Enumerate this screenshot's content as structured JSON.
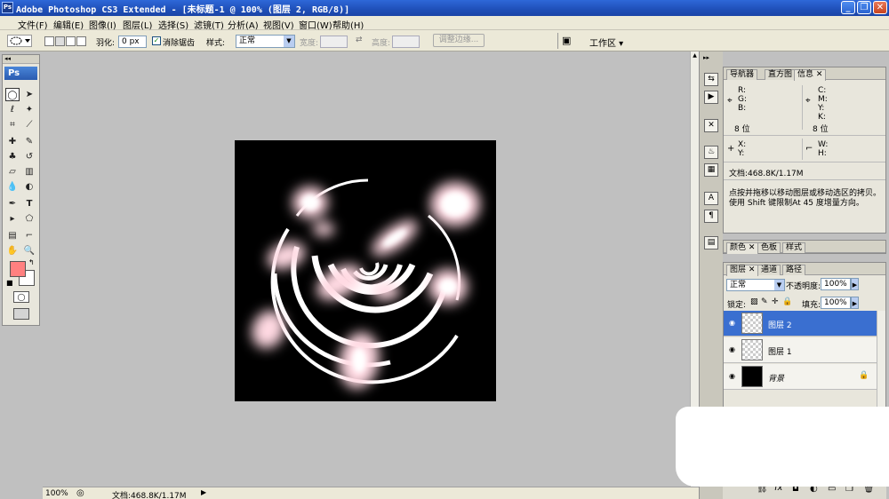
{
  "window": {
    "app_icon": "Ps",
    "title": "Adobe Photoshop CS3 Extended - [未标题-1 @ 100% (图层 2, RGB/8)]",
    "controls": [
      "_",
      "❐",
      "✕"
    ]
  },
  "menu": [
    "文件(F)",
    "编辑(E)",
    "图像(I)",
    "图层(L)",
    "选择(S)",
    "滤镜(T)",
    "分析(A)",
    "视图(V)",
    "窗口(W)",
    "帮助(H)"
  ],
  "options": {
    "feather_label": "羽化:",
    "feather_value": "0 px",
    "antialias_label": "消除锯齿",
    "antialias_checked": true,
    "style_label": "样式:",
    "style_value": "正常",
    "width_label": "宽度:",
    "height_label": "高度:",
    "refine_button": "调整边缘...",
    "workspace_label": "工作区 ▾"
  },
  "toolbox": {
    "header": "Ps",
    "foreground_color": "#ff8080",
    "background_color": "#ffffff"
  },
  "info_panel": {
    "tabs": [
      "导航器",
      "直方图",
      "信息"
    ],
    "active_tab": "信息",
    "rgb_labels": [
      "R:",
      "G:",
      "B:"
    ],
    "cmyk_labels": [
      "C:",
      "M:",
      "Y:",
      "K:"
    ],
    "bits_left": "8 位",
    "bits_right": "8 位",
    "xy_labels": [
      "X:",
      "Y:"
    ],
    "wh_labels": [
      "W:",
      "H:"
    ],
    "doc_size": "文档:468.8K/1.17M",
    "hint_line1": "点按并拖移以移动图层或移动选区的拷贝。",
    "hint_line2": "使用 Shift 键限制At 45 度增量方向。"
  },
  "color_panel": {
    "tabs": [
      "颜色",
      "色板",
      "样式"
    ]
  },
  "layers_panel": {
    "tabs": [
      "图层",
      "通道",
      "路径"
    ],
    "blend_mode": "正常",
    "opacity_label": "不透明度:",
    "opacity_value": "100%",
    "lock_label": "锁定:",
    "fill_label": "填充:",
    "fill_value": "100%",
    "layers": [
      {
        "name": "图层 2",
        "active": true,
        "thumb": "transparent"
      },
      {
        "name": "图层 1",
        "active": false,
        "thumb": "transparent"
      },
      {
        "name": "背景",
        "active": false,
        "thumb": "black"
      }
    ]
  },
  "status": {
    "zoom": "100%",
    "doc_size": "文档:468.8K/1.17M"
  },
  "colors": {
    "title_blue": "#2e68d8",
    "active_layer": "#3a6fd0",
    "canvas_bg": "#c0c0c0",
    "glow": "#ffd8e0"
  }
}
